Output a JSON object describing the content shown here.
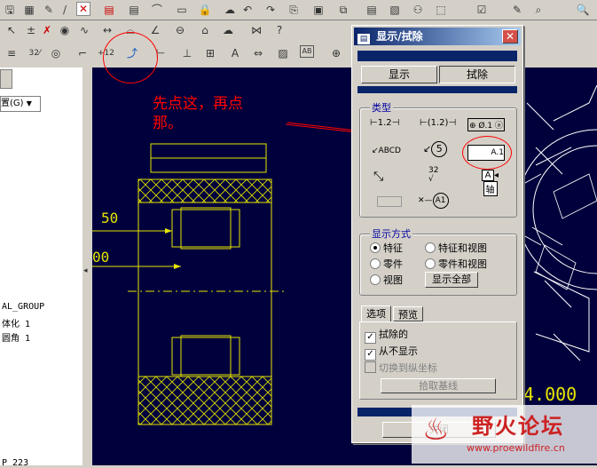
{
  "toolbar": {
    "row1_icons": [
      "save-icon",
      "print-icon",
      "cut-icon",
      "close-x-icon",
      "measure-icon",
      "datum-icon",
      "arc-dim-icon",
      "text-icon",
      "lock-icon",
      "cloud-icon",
      "split-icon",
      "help-icon",
      "undo-icon",
      "redo-icon",
      "copy-icon",
      "paste-icon",
      "grid-icon",
      "select-icon",
      "checkbox-icon",
      "zoom-icon"
    ],
    "row2_icons": [
      "table-icon",
      "angle-dim-icon",
      "tolerance-icon",
      "circle-dim-icon",
      "datum-a-icon",
      "highlighted-annotation-icon",
      "dim-icon",
      "ordinate-icon",
      "grid-table-icon",
      "text-style-icon",
      "move-icon",
      "hatch-icon",
      "mask-icon",
      "surface-finish-icon"
    ],
    "row2_labels": {
      "fraction": "32⁄",
      "pos": "+12",
      "mask": "AB"
    }
  },
  "left_panel": {
    "dropdown_label": "置(G)",
    "tree_lines": [
      "AL_GROUP",
      "体化 1",
      "圆角 1"
    ],
    "bottom_text": "P 223"
  },
  "annotation": {
    "text": "先点这，再点那。",
    "color": "#ff0000"
  },
  "drawing": {
    "dim1": "50",
    "dim2": "00",
    "dim3": "4.000"
  },
  "dialog": {
    "title": "显示/拭除",
    "tab_show": "显示",
    "tab_erase": "拭除",
    "type_group_label": "类型",
    "type_icons": {
      "dim1": "1.2",
      "dim2": "(1.2)",
      "gtol": "⊕ Ø.1 ⓐ",
      "note": "ABCD",
      "balloon": "5",
      "datum_box": "A.1",
      "finish": "32",
      "axis_box": "A",
      "axis_label": "轴",
      "datum_target": "A1"
    },
    "display_mode_label": "显示方式",
    "display_options": [
      {
        "label": "特征",
        "selected": true
      },
      {
        "label": "特征和视图",
        "selected": false
      },
      {
        "label": "零件",
        "selected": false
      },
      {
        "label": "零件和视图",
        "selected": false
      },
      {
        "label": "视图",
        "selected": false
      }
    ],
    "show_all_button": "显示全部",
    "option_tabs": [
      "选项",
      "预览"
    ],
    "checkboxes": [
      {
        "label": "拭除的",
        "checked": true,
        "enabled": true
      },
      {
        "label": "从不显示",
        "checked": true,
        "enabled": true
      },
      {
        "label": "切换到纵坐标",
        "checked": false,
        "enabled": false
      }
    ],
    "pick_baseline_button": "拾取基线",
    "close_button": "关闭"
  },
  "watermark": {
    "title": "野火论坛",
    "url": "www.proewildfire.cn"
  }
}
